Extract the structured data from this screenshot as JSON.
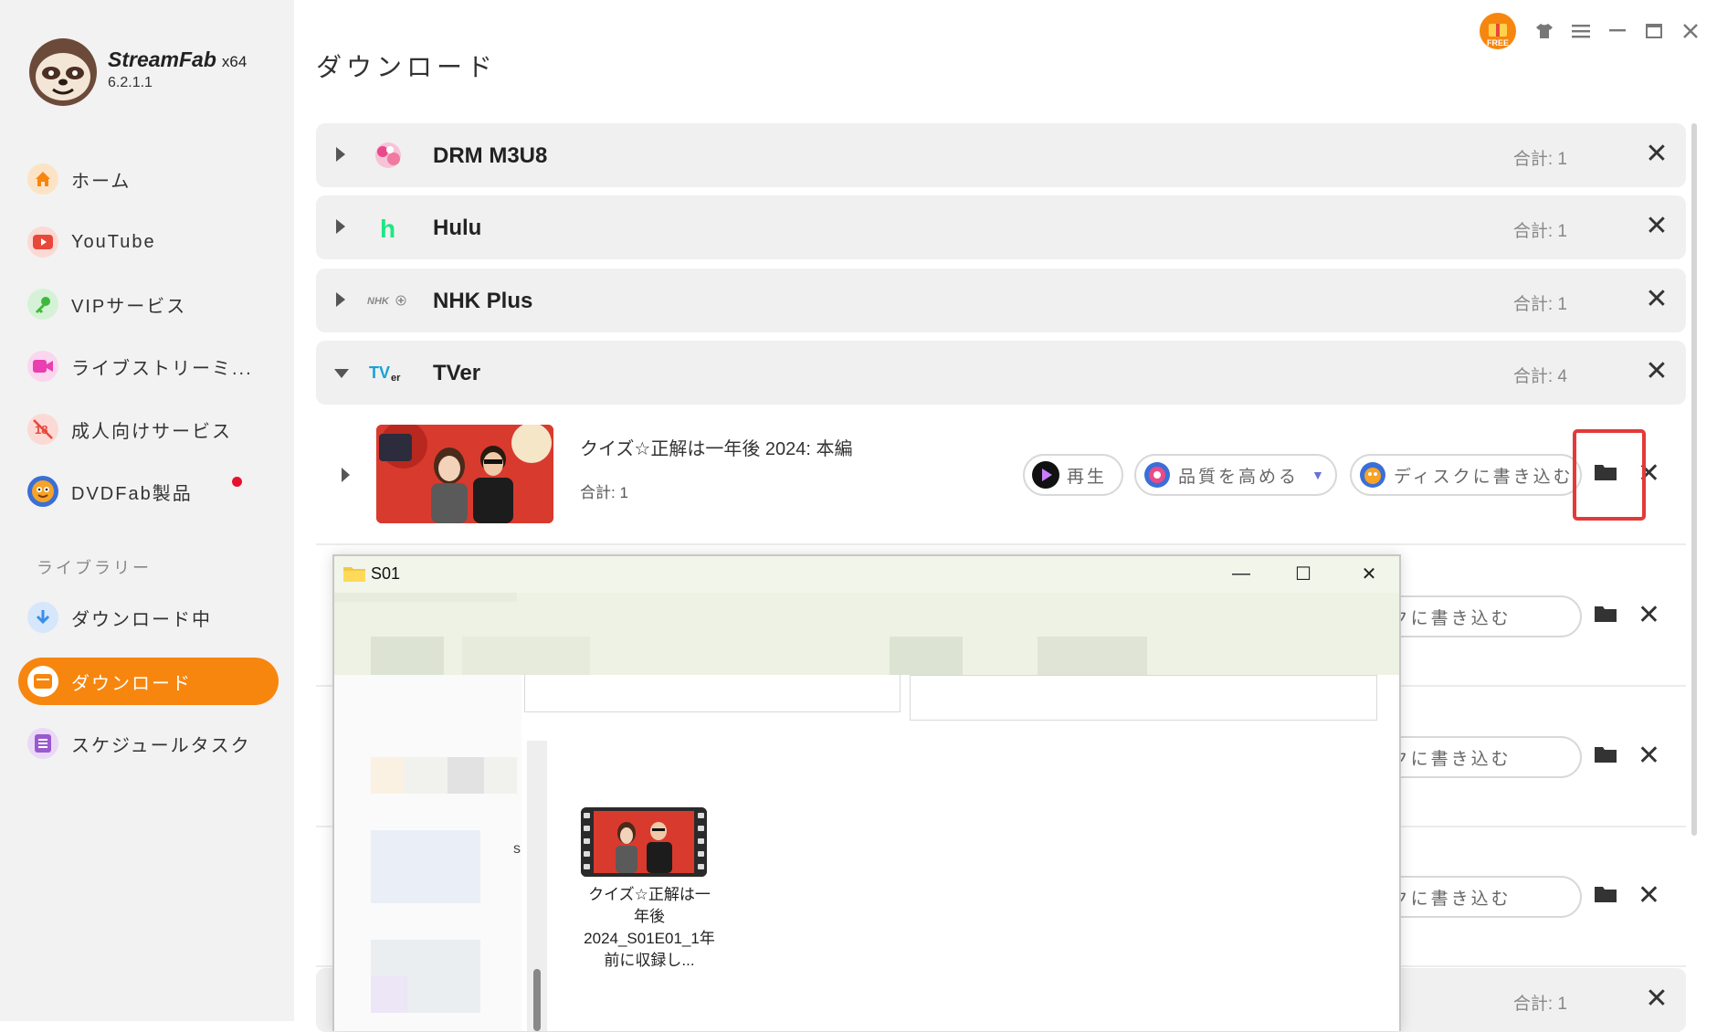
{
  "app": {
    "name": "StreamFab",
    "arch": "x64",
    "version": "6.2.1.1",
    "free_badge": "FREE"
  },
  "sidebar": {
    "items": [
      {
        "label": "ホーム",
        "icon": "home-icon",
        "color": "#f7860e"
      },
      {
        "label": "YouTube",
        "icon": "youtube-icon",
        "color": "#e8483a"
      },
      {
        "label": "VIPサービス",
        "icon": "key-icon",
        "color": "#3cba3c"
      },
      {
        "label": "ライブストリーミ...",
        "icon": "live-camera-icon",
        "color": "#ea3fb0"
      },
      {
        "label": "成人向けサービス",
        "icon": "adult-18-icon",
        "color": "#e8483a"
      },
      {
        "label": "DVDFab製品",
        "icon": "dvdfab-icon",
        "color": "#f7860e"
      }
    ],
    "library_label": "ライブラリー",
    "library_items": [
      {
        "label": "ダウンロード中",
        "icon": "download-arrow-icon",
        "color": "#3a8ee8"
      },
      {
        "label": "ダウンロード",
        "icon": "downloaded-folder-icon",
        "color": "#f7860e"
      },
      {
        "label": "スケジュールタスク",
        "icon": "schedule-list-icon",
        "color": "#9b59d0"
      }
    ]
  },
  "page": {
    "title": "ダウンロード"
  },
  "groups": [
    {
      "name": "DRM M3U8",
      "total": "合計: 1",
      "icon": "drm-m3u8-icon"
    },
    {
      "name": "Hulu",
      "total": "合計: 1",
      "icon": "hulu-icon"
    },
    {
      "name": "NHK Plus",
      "total": "合計: 1",
      "icon": "nhk-plus-icon"
    },
    {
      "name": "TVer",
      "total": "合計: 4",
      "icon": "tver-icon"
    }
  ],
  "bottom_group": {
    "total": "合計: 1"
  },
  "episode": {
    "title": "クイズ☆正解は一年後 2024: 本編",
    "total": "合計: 1",
    "play_label": "再生",
    "quality_label": "品質を高める",
    "burn_label": "ディスクに書き込む"
  },
  "extra_rows": [
    {
      "burn_label": "ディスクに書き込む"
    },
    {
      "burn_label": "ディスクに書き込む"
    },
    {
      "burn_label": "ディスクに書き込む"
    }
  ],
  "explorer": {
    "title": "S01",
    "file_name": "クイズ☆正解は一年後 2024_S01E01_1年前に収録し...",
    "side_fragment": "s"
  }
}
